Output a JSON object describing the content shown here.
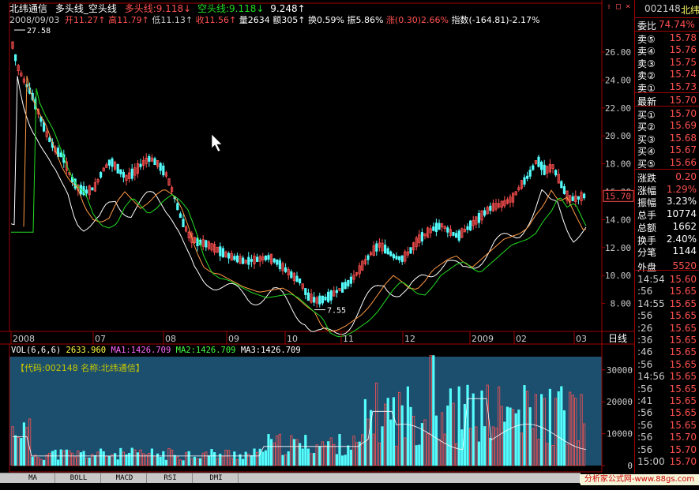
{
  "header": {
    "title": "北纬通信",
    "indicator": "多头线_空头线",
    "bull_label": "多头线:",
    "bull_value": "9.118",
    "bull_arrow": "↓",
    "bear_label": "空头线:",
    "bear_value": "9.118",
    "bear_arrow": "↓",
    "extra_value": "9.248",
    "extra_arrow": "↑",
    "date": "2008/09/03",
    "open_label": "开",
    "open": "11.27",
    "high_label": "高",
    "high": "11.79",
    "low_label": "低",
    "low": "11.13",
    "close_label": "收",
    "close": "11.56",
    "vol_label": "量",
    "vol": "2634",
    "amount_label": "额",
    "amount": "305",
    "turnover_label": "换",
    "turnover": "0.59%",
    "amplitude_label": "振",
    "amplitude": "5.86%",
    "change_label": "涨",
    "change": "(0.30)",
    "change_pct": "2.66%",
    "index_label": "指数",
    "index": "(-164.81)-2.17%"
  },
  "price_axis": {
    "ticks": [
      "26.00",
      "24.00",
      "22.00",
      "20.00",
      "18.00",
      "16.00",
      "14.00",
      "12.00",
      "10.00",
      "8.00"
    ],
    "current": "15.70",
    "max_mark": "27.58",
    "min_mark": "7.55"
  },
  "time_axis": {
    "labels": [
      "2008",
      "07",
      "08",
      "09",
      "10",
      "11",
      "12",
      "2009",
      "02",
      "03"
    ],
    "period": "日线"
  },
  "volume_panel": {
    "title": "VOL(6,6,6)",
    "vol_value": "2633.960",
    "ma1_label": "MA1:1426.709",
    "ma2_label": "MA2:1426.709",
    "ma3_label": "MA3:1426.709",
    "info": "【代码:002148 名称:北纬通信】",
    "ticks": [
      "30000",
      "20000",
      "10000",
      "0"
    ]
  },
  "sidebar": {
    "code": "002148",
    "name": "北纬",
    "weibi_label": "委比",
    "weibi": "74.74%",
    "asks": [
      {
        "label": "卖⑤",
        "price": "15.78"
      },
      {
        "label": "卖④",
        "price": "15.76"
      },
      {
        "label": "卖③",
        "price": "15.75"
      },
      {
        "label": "卖②",
        "price": "15.74"
      },
      {
        "label": "卖①",
        "price": "15.73"
      }
    ],
    "last_label": "最新",
    "last": "15.70",
    "bids": [
      {
        "label": "买①",
        "price": "15.70"
      },
      {
        "label": "买②",
        "price": "15.69"
      },
      {
        "label": "买③",
        "price": "15.68"
      },
      {
        "label": "买④",
        "price": "15.67"
      },
      {
        "label": "买⑤",
        "price": "15.66"
      }
    ],
    "stats": [
      {
        "label": "涨跌",
        "value": "0.20"
      },
      {
        "label": "涨幅",
        "value": "1.29%"
      },
      {
        "label": "振幅",
        "value": "3.23%"
      },
      {
        "label": "总手",
        "value": "10774"
      },
      {
        "label": "总额",
        "value": "1662"
      },
      {
        "label": "换手",
        "value": "2.40%"
      },
      {
        "label": "分笔",
        "value": "1144"
      },
      {
        "label": "外盘",
        "value": "5520"
      }
    ],
    "ticks": [
      {
        "time": "14:54",
        "price": "15.60"
      },
      {
        "time": ":56",
        "price": "15.65"
      },
      {
        "time": "14:55",
        "price": "15.65"
      },
      {
        "time": ":56",
        "price": "15.65"
      },
      {
        "time": ":26",
        "price": "15.65"
      },
      {
        "time": ":36",
        "price": "15.65"
      },
      {
        "time": ":46",
        "price": "15.65"
      },
      {
        "time": ":56",
        "price": "15.65"
      },
      {
        "time": "14:56",
        "price": "15.65"
      },
      {
        "time": ":56",
        "price": "15.65"
      },
      {
        "time": ":41",
        "price": "15.65"
      },
      {
        "time": ":56",
        "price": "15.65"
      },
      {
        "time": ":56",
        "price": "15.65"
      },
      {
        "time": ":56",
        "price": "15.70"
      },
      {
        "time": ":56",
        "price": "15.70"
      },
      {
        "time": "15:00",
        "price": "15.70"
      }
    ]
  },
  "tabs": [
    "MA",
    "BOLL",
    "MACD",
    "RSI",
    "DMI"
  ],
  "footer": {
    "watermark": "分析家公式网-www.88gs.com"
  },
  "colors": {
    "up": "#ff5050",
    "down": "#54fcfc",
    "ma_white": "#ffffff",
    "ma_orange": "#ff9944",
    "ma_green": "#22dd22",
    "grid": "#a00000",
    "info_panel": "#1c4f6e",
    "info_text": "#c8c800"
  }
}
